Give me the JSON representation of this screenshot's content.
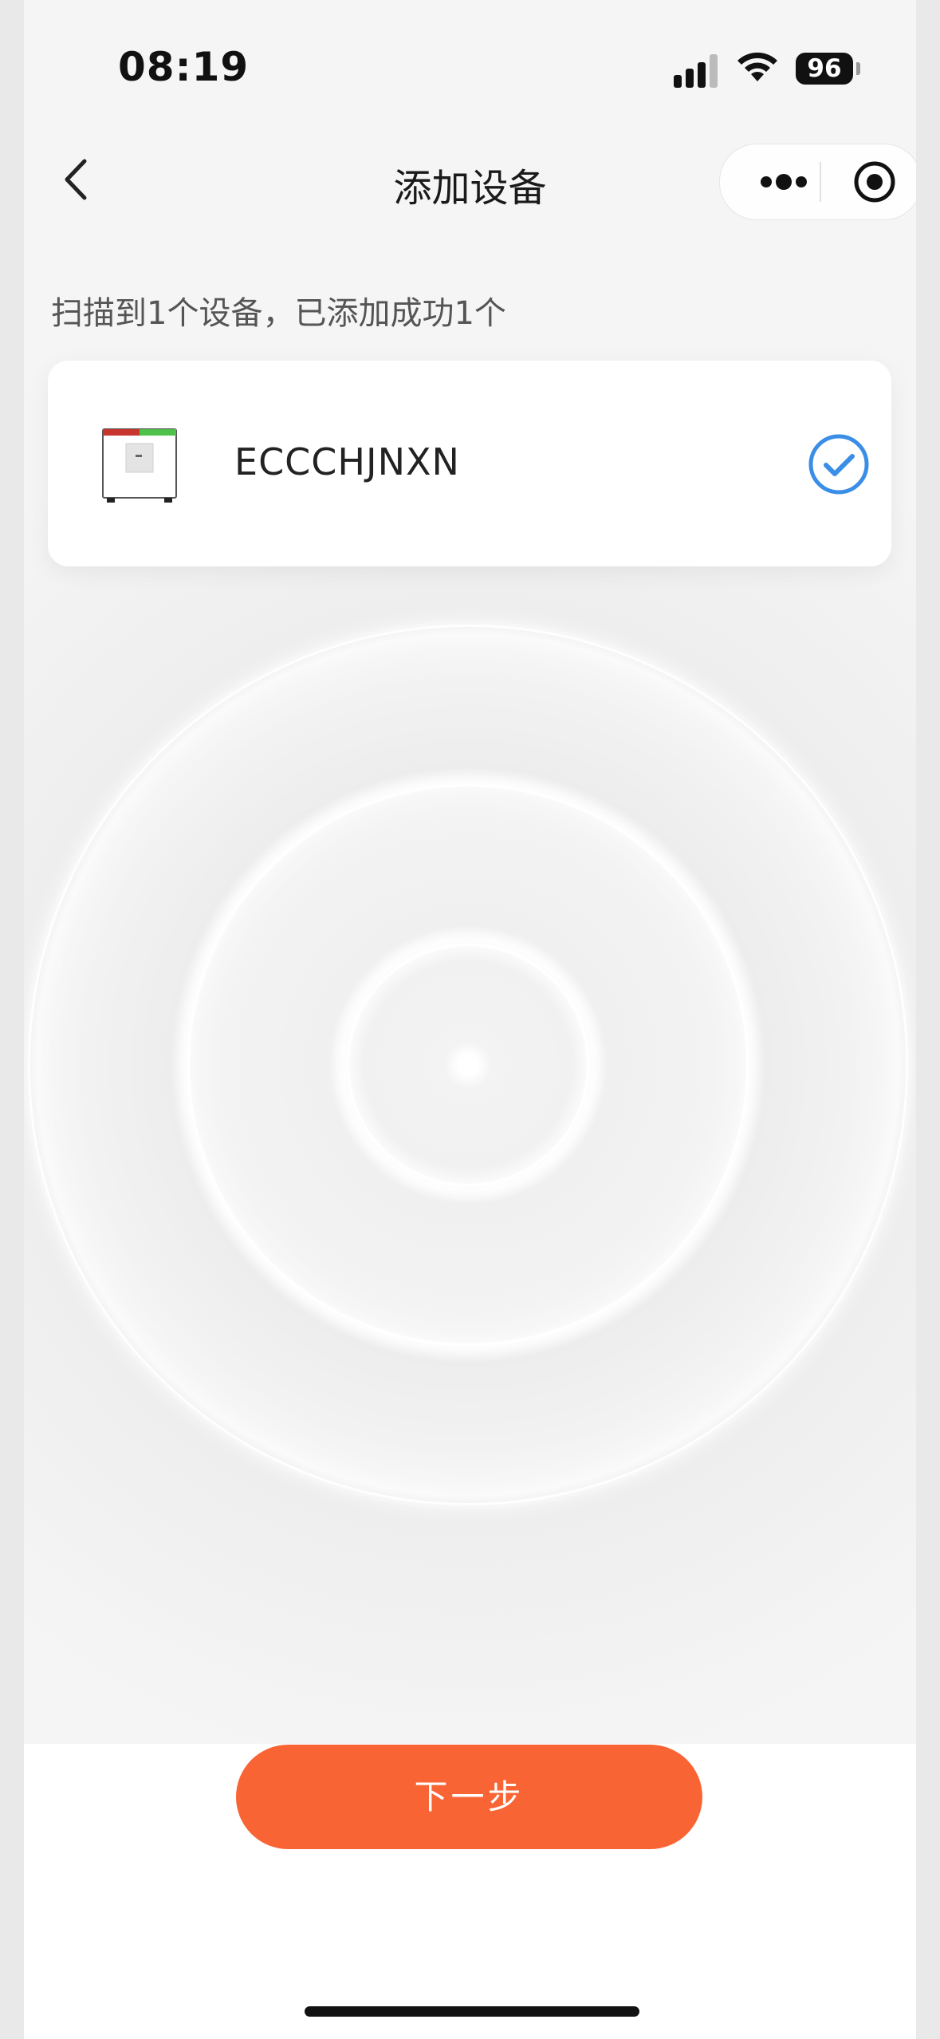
{
  "status_bar": {
    "time": "08:19",
    "battery": "96"
  },
  "nav": {
    "title": "添加设备",
    "back_icon": "chevron-left-icon",
    "more_icon": "more-dots-icon",
    "close_icon": "target-close-icon"
  },
  "scan": {
    "summary": "扫描到1个设备，已添加成功1个"
  },
  "devices": [
    {
      "name": "ECCCHJNXN",
      "selected": true
    }
  ],
  "actions": {
    "next_label": "下一步"
  },
  "colors": {
    "accent": "#f96434",
    "check_blue": "#3a8ee6"
  }
}
